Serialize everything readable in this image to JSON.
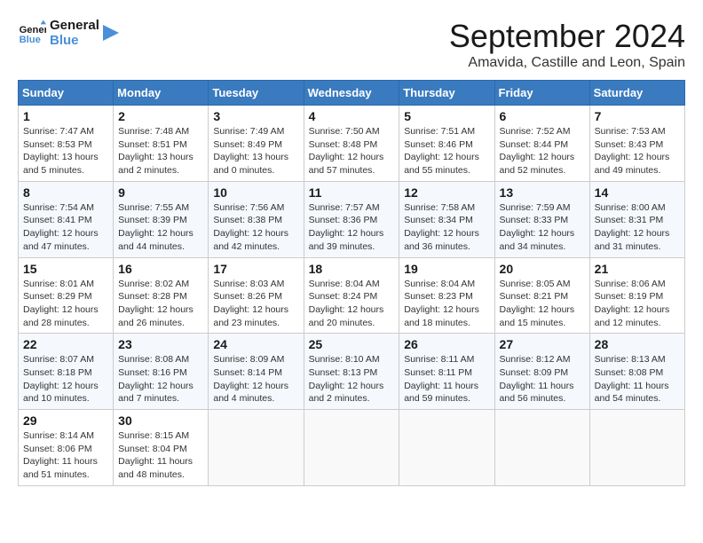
{
  "header": {
    "logo_line1": "General",
    "logo_line2": "Blue",
    "month_year": "September 2024",
    "location": "Amavida, Castille and Leon, Spain"
  },
  "days_of_week": [
    "Sunday",
    "Monday",
    "Tuesday",
    "Wednesday",
    "Thursday",
    "Friday",
    "Saturday"
  ],
  "weeks": [
    [
      {
        "day": "1",
        "sunrise": "7:47 AM",
        "sunset": "8:53 PM",
        "daylight": "13 hours and 5 minutes."
      },
      {
        "day": "2",
        "sunrise": "7:48 AM",
        "sunset": "8:51 PM",
        "daylight": "13 hours and 2 minutes."
      },
      {
        "day": "3",
        "sunrise": "7:49 AM",
        "sunset": "8:49 PM",
        "daylight": "13 hours and 0 minutes."
      },
      {
        "day": "4",
        "sunrise": "7:50 AM",
        "sunset": "8:48 PM",
        "daylight": "12 hours and 57 minutes."
      },
      {
        "day": "5",
        "sunrise": "7:51 AM",
        "sunset": "8:46 PM",
        "daylight": "12 hours and 55 minutes."
      },
      {
        "day": "6",
        "sunrise": "7:52 AM",
        "sunset": "8:44 PM",
        "daylight": "12 hours and 52 minutes."
      },
      {
        "day": "7",
        "sunrise": "7:53 AM",
        "sunset": "8:43 PM",
        "daylight": "12 hours and 49 minutes."
      }
    ],
    [
      {
        "day": "8",
        "sunrise": "7:54 AM",
        "sunset": "8:41 PM",
        "daylight": "12 hours and 47 minutes."
      },
      {
        "day": "9",
        "sunrise": "7:55 AM",
        "sunset": "8:39 PM",
        "daylight": "12 hours and 44 minutes."
      },
      {
        "day": "10",
        "sunrise": "7:56 AM",
        "sunset": "8:38 PM",
        "daylight": "12 hours and 42 minutes."
      },
      {
        "day": "11",
        "sunrise": "7:57 AM",
        "sunset": "8:36 PM",
        "daylight": "12 hours and 39 minutes."
      },
      {
        "day": "12",
        "sunrise": "7:58 AM",
        "sunset": "8:34 PM",
        "daylight": "12 hours and 36 minutes."
      },
      {
        "day": "13",
        "sunrise": "7:59 AM",
        "sunset": "8:33 PM",
        "daylight": "12 hours and 34 minutes."
      },
      {
        "day": "14",
        "sunrise": "8:00 AM",
        "sunset": "8:31 PM",
        "daylight": "12 hours and 31 minutes."
      }
    ],
    [
      {
        "day": "15",
        "sunrise": "8:01 AM",
        "sunset": "8:29 PM",
        "daylight": "12 hours and 28 minutes."
      },
      {
        "day": "16",
        "sunrise": "8:02 AM",
        "sunset": "8:28 PM",
        "daylight": "12 hours and 26 minutes."
      },
      {
        "day": "17",
        "sunrise": "8:03 AM",
        "sunset": "8:26 PM",
        "daylight": "12 hours and 23 minutes."
      },
      {
        "day": "18",
        "sunrise": "8:04 AM",
        "sunset": "8:24 PM",
        "daylight": "12 hours and 20 minutes."
      },
      {
        "day": "19",
        "sunrise": "8:04 AM",
        "sunset": "8:23 PM",
        "daylight": "12 hours and 18 minutes."
      },
      {
        "day": "20",
        "sunrise": "8:05 AM",
        "sunset": "8:21 PM",
        "daylight": "12 hours and 15 minutes."
      },
      {
        "day": "21",
        "sunrise": "8:06 AM",
        "sunset": "8:19 PM",
        "daylight": "12 hours and 12 minutes."
      }
    ],
    [
      {
        "day": "22",
        "sunrise": "8:07 AM",
        "sunset": "8:18 PM",
        "daylight": "12 hours and 10 minutes."
      },
      {
        "day": "23",
        "sunrise": "8:08 AM",
        "sunset": "8:16 PM",
        "daylight": "12 hours and 7 minutes."
      },
      {
        "day": "24",
        "sunrise": "8:09 AM",
        "sunset": "8:14 PM",
        "daylight": "12 hours and 4 minutes."
      },
      {
        "day": "25",
        "sunrise": "8:10 AM",
        "sunset": "8:13 PM",
        "daylight": "12 hours and 2 minutes."
      },
      {
        "day": "26",
        "sunrise": "8:11 AM",
        "sunset": "8:11 PM",
        "daylight": "11 hours and 59 minutes."
      },
      {
        "day": "27",
        "sunrise": "8:12 AM",
        "sunset": "8:09 PM",
        "daylight": "11 hours and 56 minutes."
      },
      {
        "day": "28",
        "sunrise": "8:13 AM",
        "sunset": "8:08 PM",
        "daylight": "11 hours and 54 minutes."
      }
    ],
    [
      {
        "day": "29",
        "sunrise": "8:14 AM",
        "sunset": "8:06 PM",
        "daylight": "11 hours and 51 minutes."
      },
      {
        "day": "30",
        "sunrise": "8:15 AM",
        "sunset": "8:04 PM",
        "daylight": "11 hours and 48 minutes."
      },
      null,
      null,
      null,
      null,
      null
    ]
  ]
}
